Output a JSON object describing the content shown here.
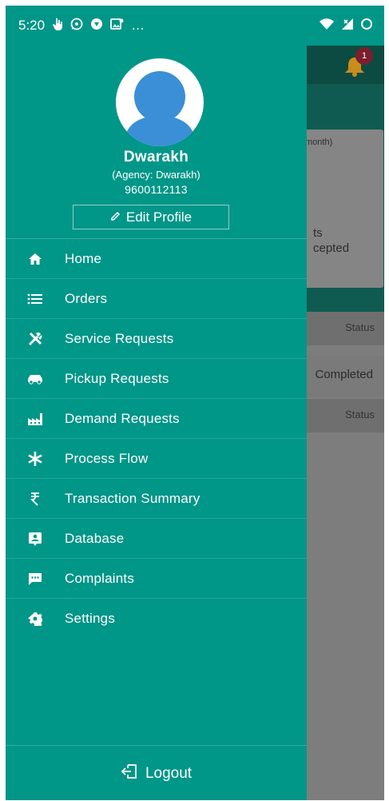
{
  "status_bar": {
    "time": "5:20",
    "left_icons": [
      "hand-icon",
      "whatsapp-icon",
      "shield-icon",
      "image-icon",
      "more-dots"
    ],
    "more": "…",
    "right_icons": [
      "wifi-icon",
      "signal-icon",
      "battery-circle-icon"
    ]
  },
  "colors": {
    "drawer_bg": "#009688",
    "toolbar_dim": "#0c4b41",
    "bell": "#e8a51e"
  },
  "background_app": {
    "notification_count": "1",
    "card_text_top": "month)",
    "card_text_line1": "ts",
    "card_text_line2": "cepted",
    "header1_label": "Status",
    "row_status": "Completed",
    "header2_label": "Status"
  },
  "profile": {
    "name": "Dwarakh",
    "agency": "(Agency: Dwarakh)",
    "phone": "9600112113",
    "edit_label": "Edit Profile"
  },
  "menu": {
    "items": [
      {
        "label": "Home",
        "icon": "home-icon"
      },
      {
        "label": "Orders",
        "icon": "list-icon"
      },
      {
        "label": "Service Requests",
        "icon": "tools-icon"
      },
      {
        "label": "Pickup Requests",
        "icon": "car-icon"
      },
      {
        "label": "Demand Requests",
        "icon": "factory-icon"
      },
      {
        "label": "Process Flow",
        "icon": "asterisk-icon"
      },
      {
        "label": "Transaction Summary",
        "icon": "rupee-icon"
      },
      {
        "label": "Database",
        "icon": "contact-card-icon"
      },
      {
        "label": "Complaints",
        "icon": "chat-icon"
      },
      {
        "label": "Settings",
        "icon": "gear-icon"
      }
    ]
  },
  "logout": {
    "label": "Logout"
  }
}
